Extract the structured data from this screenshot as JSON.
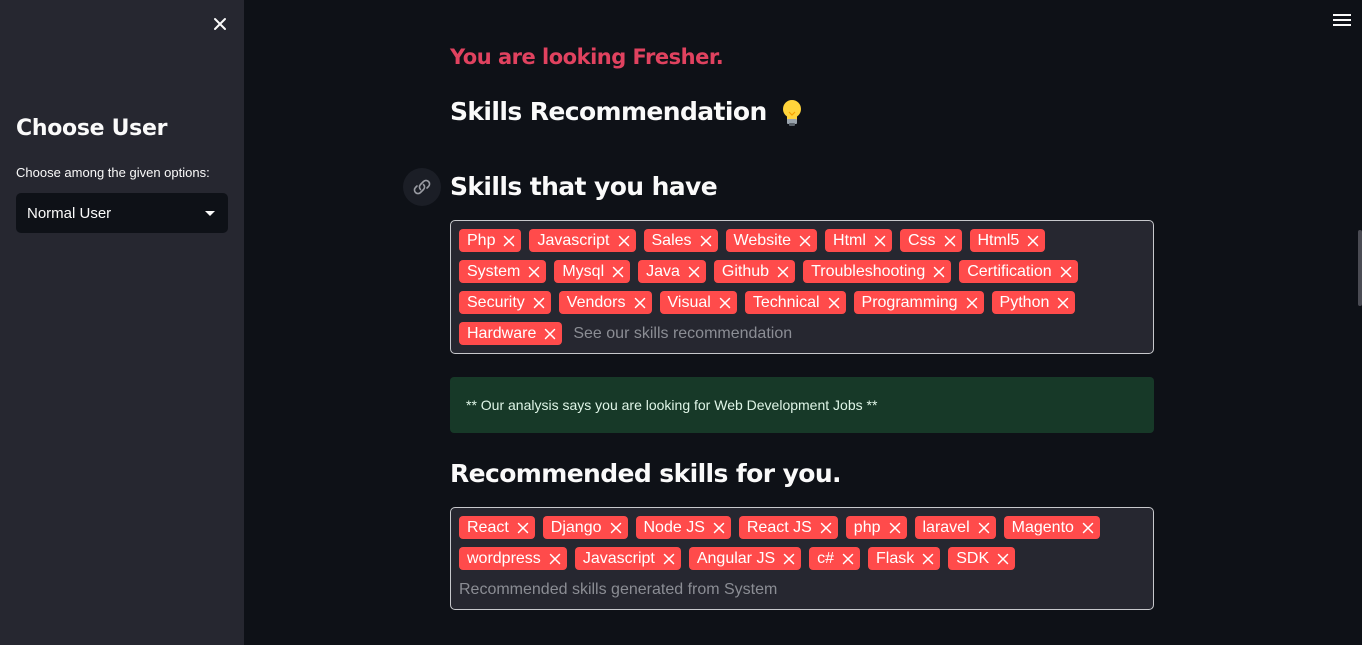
{
  "sidebar": {
    "title": "Choose User",
    "select_label": "Choose among the given options:",
    "select_value": "Normal User"
  },
  "main": {
    "experience_text": "You are looking Fresher.",
    "skills_rec_heading": "Skills Recommendation",
    "skills_have_heading": "Skills that you have",
    "skills_have": [
      "Php",
      "Javascript",
      "Sales",
      "Website",
      "Html",
      "Css",
      "Html5",
      "System",
      "Mysql",
      "Java",
      "Github",
      "Troubleshooting",
      "Certification",
      "Security",
      "Vendors",
      "Visual",
      "Technical",
      "Programming",
      "Python",
      "Hardware"
    ],
    "skills_have_placeholder": "See our skills recommendation",
    "analysis_text": "** Our analysis says you are looking for Web Development Jobs **",
    "recommended_heading": "Recommended skills for you.",
    "recommended_skills": [
      "React",
      "Django",
      "Node JS",
      "React JS",
      "php",
      "laravel",
      "Magento",
      "wordpress",
      "Javascript",
      "Angular JS",
      "c#",
      "Flask",
      "SDK"
    ],
    "recommended_placeholder": "Recommended skills generated from System"
  },
  "colors": {
    "tag_bg": "#ff4b4b",
    "accent_red_text": "#e0425f",
    "success_bg": "#173928",
    "sidebar_bg": "#262730",
    "app_bg": "#0e1117"
  }
}
